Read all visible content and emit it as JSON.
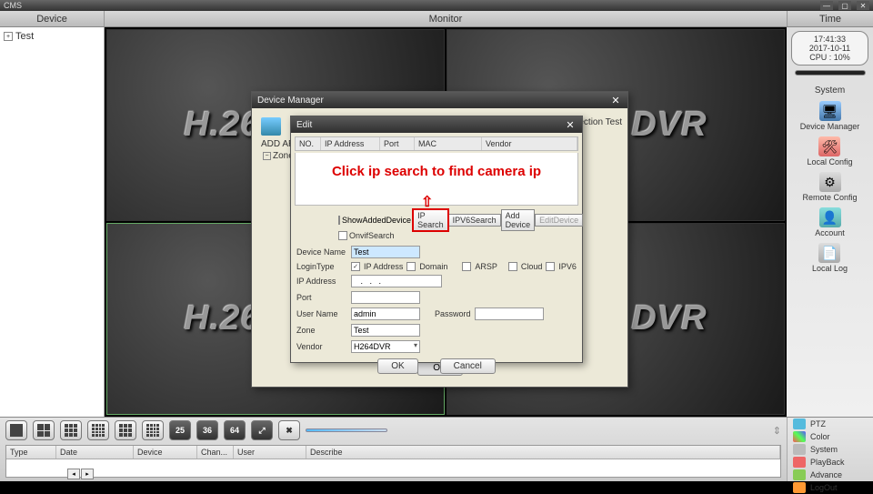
{
  "app": {
    "title": "CMS"
  },
  "header": {
    "device": "Device",
    "monitor": "Monitor",
    "time": "Time"
  },
  "tree": {
    "root": "Test"
  },
  "status": {
    "clock": "17:41:33",
    "date": "2017-10-11",
    "cpu": "CPU : 10%"
  },
  "right_tools": {
    "section": "System",
    "items": [
      {
        "label": "Device Manager"
      },
      {
        "label": "Local Config"
      },
      {
        "label": "Remote Config"
      },
      {
        "label": "Account"
      },
      {
        "label": "Local Log"
      }
    ]
  },
  "watermark": [
    "H.264 DVR",
    "H.264 DVR",
    "H.264 DVR",
    "H.264 DVR"
  ],
  "grid_btns": [
    "25",
    "36",
    "64"
  ],
  "log_cols": [
    "Type",
    "Date",
    "Device",
    "Chan...",
    "User",
    "Describe"
  ],
  "bottom_menu": [
    "PTZ",
    "Color",
    "System",
    "PlayBack",
    "Advance",
    "LogOut"
  ],
  "dlg_manager": {
    "title": "Device Manager",
    "add": "ADD AREA",
    "zone": "Zone",
    "conn_label": "Connection Test",
    "ok": "OK"
  },
  "dlg_edit": {
    "title": "Edit",
    "cols": [
      "NO.",
      "IP Address",
      "Port",
      "MAC",
      "Vendor"
    ],
    "overlay": "Click ip search to find camera ip",
    "chk_show": "ShowAddedDevice",
    "chk_onvif": "OnvifSearch",
    "btn_ipsearch": "IP Search",
    "btn_ipv6search": "IPV6Search",
    "btn_adddevice": "Add Device",
    "btn_editdevice": "EditDevice",
    "labels": {
      "device_name": "Device Name",
      "login_type": "LoginType",
      "ip_address": "IP Address",
      "port": "Port",
      "user_name": "User Name",
      "password": "Password",
      "zone": "Zone",
      "vendor": "Vendor"
    },
    "login_opts": {
      "ip": "IP Address",
      "domain": "Domain",
      "arsp": "ARSP",
      "cloud": "Cloud",
      "ipv6": "IPV6"
    },
    "values": {
      "device_name": "Test",
      "ip_address": "   .   .   .   ",
      "port": "",
      "user_name": "admin",
      "password": "",
      "zone": "Test",
      "vendor": "H264DVR"
    },
    "ok": "OK",
    "cancel": "Cancel"
  }
}
